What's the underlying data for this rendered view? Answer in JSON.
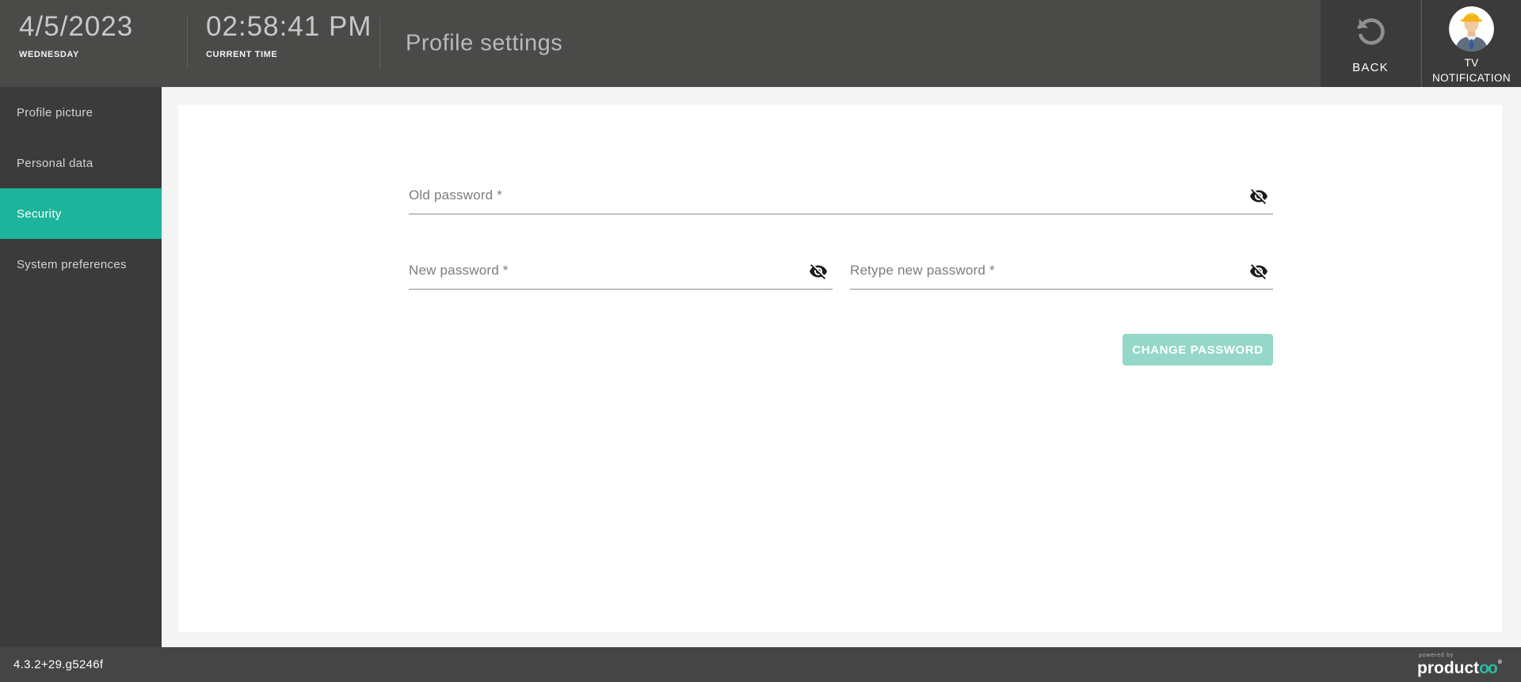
{
  "header": {
    "date": {
      "value": "4/5/2023",
      "label": "WEDNESDAY"
    },
    "time": {
      "value": "02:58:41 PM",
      "label": "CURRENT TIME"
    },
    "title": "Profile settings",
    "back_label": "BACK",
    "user": {
      "line1": "TV",
      "line2": "NOTIFICATION"
    }
  },
  "sidebar": {
    "items": [
      {
        "label": "Profile picture",
        "active": false
      },
      {
        "label": "Personal data",
        "active": false
      },
      {
        "label": "Security",
        "active": true
      },
      {
        "label": "System preferences",
        "active": false
      }
    ]
  },
  "form": {
    "fields": [
      {
        "label": "Old password *",
        "value": "",
        "masked": true
      },
      {
        "label": "New password *",
        "value": "",
        "masked": true
      },
      {
        "label": "Retype new password *",
        "value": "",
        "masked": true
      }
    ],
    "submit_label": "CHANGE PASSWORD",
    "submit_enabled": false
  },
  "footer": {
    "version": "4.3.2+29.g5246f",
    "logo": {
      "powered_by": "powered by",
      "brand_prefix": "product",
      "brand_suffix": "oo",
      "registered": "®"
    }
  },
  "icons": {
    "back": "undo-arrow-icon",
    "password_fields": "eye-off-icon",
    "avatar": "worker-avatar"
  },
  "colors": {
    "header_bg": "#4a4a48",
    "sidebar_bg": "#3b3b3b",
    "footer_bg": "#454545",
    "accent_teal": "#1cb49b",
    "disabled_button_teal": "#95d7c8",
    "content_bg": "#f5f5f5",
    "panel_bg": "#ffffff"
  }
}
